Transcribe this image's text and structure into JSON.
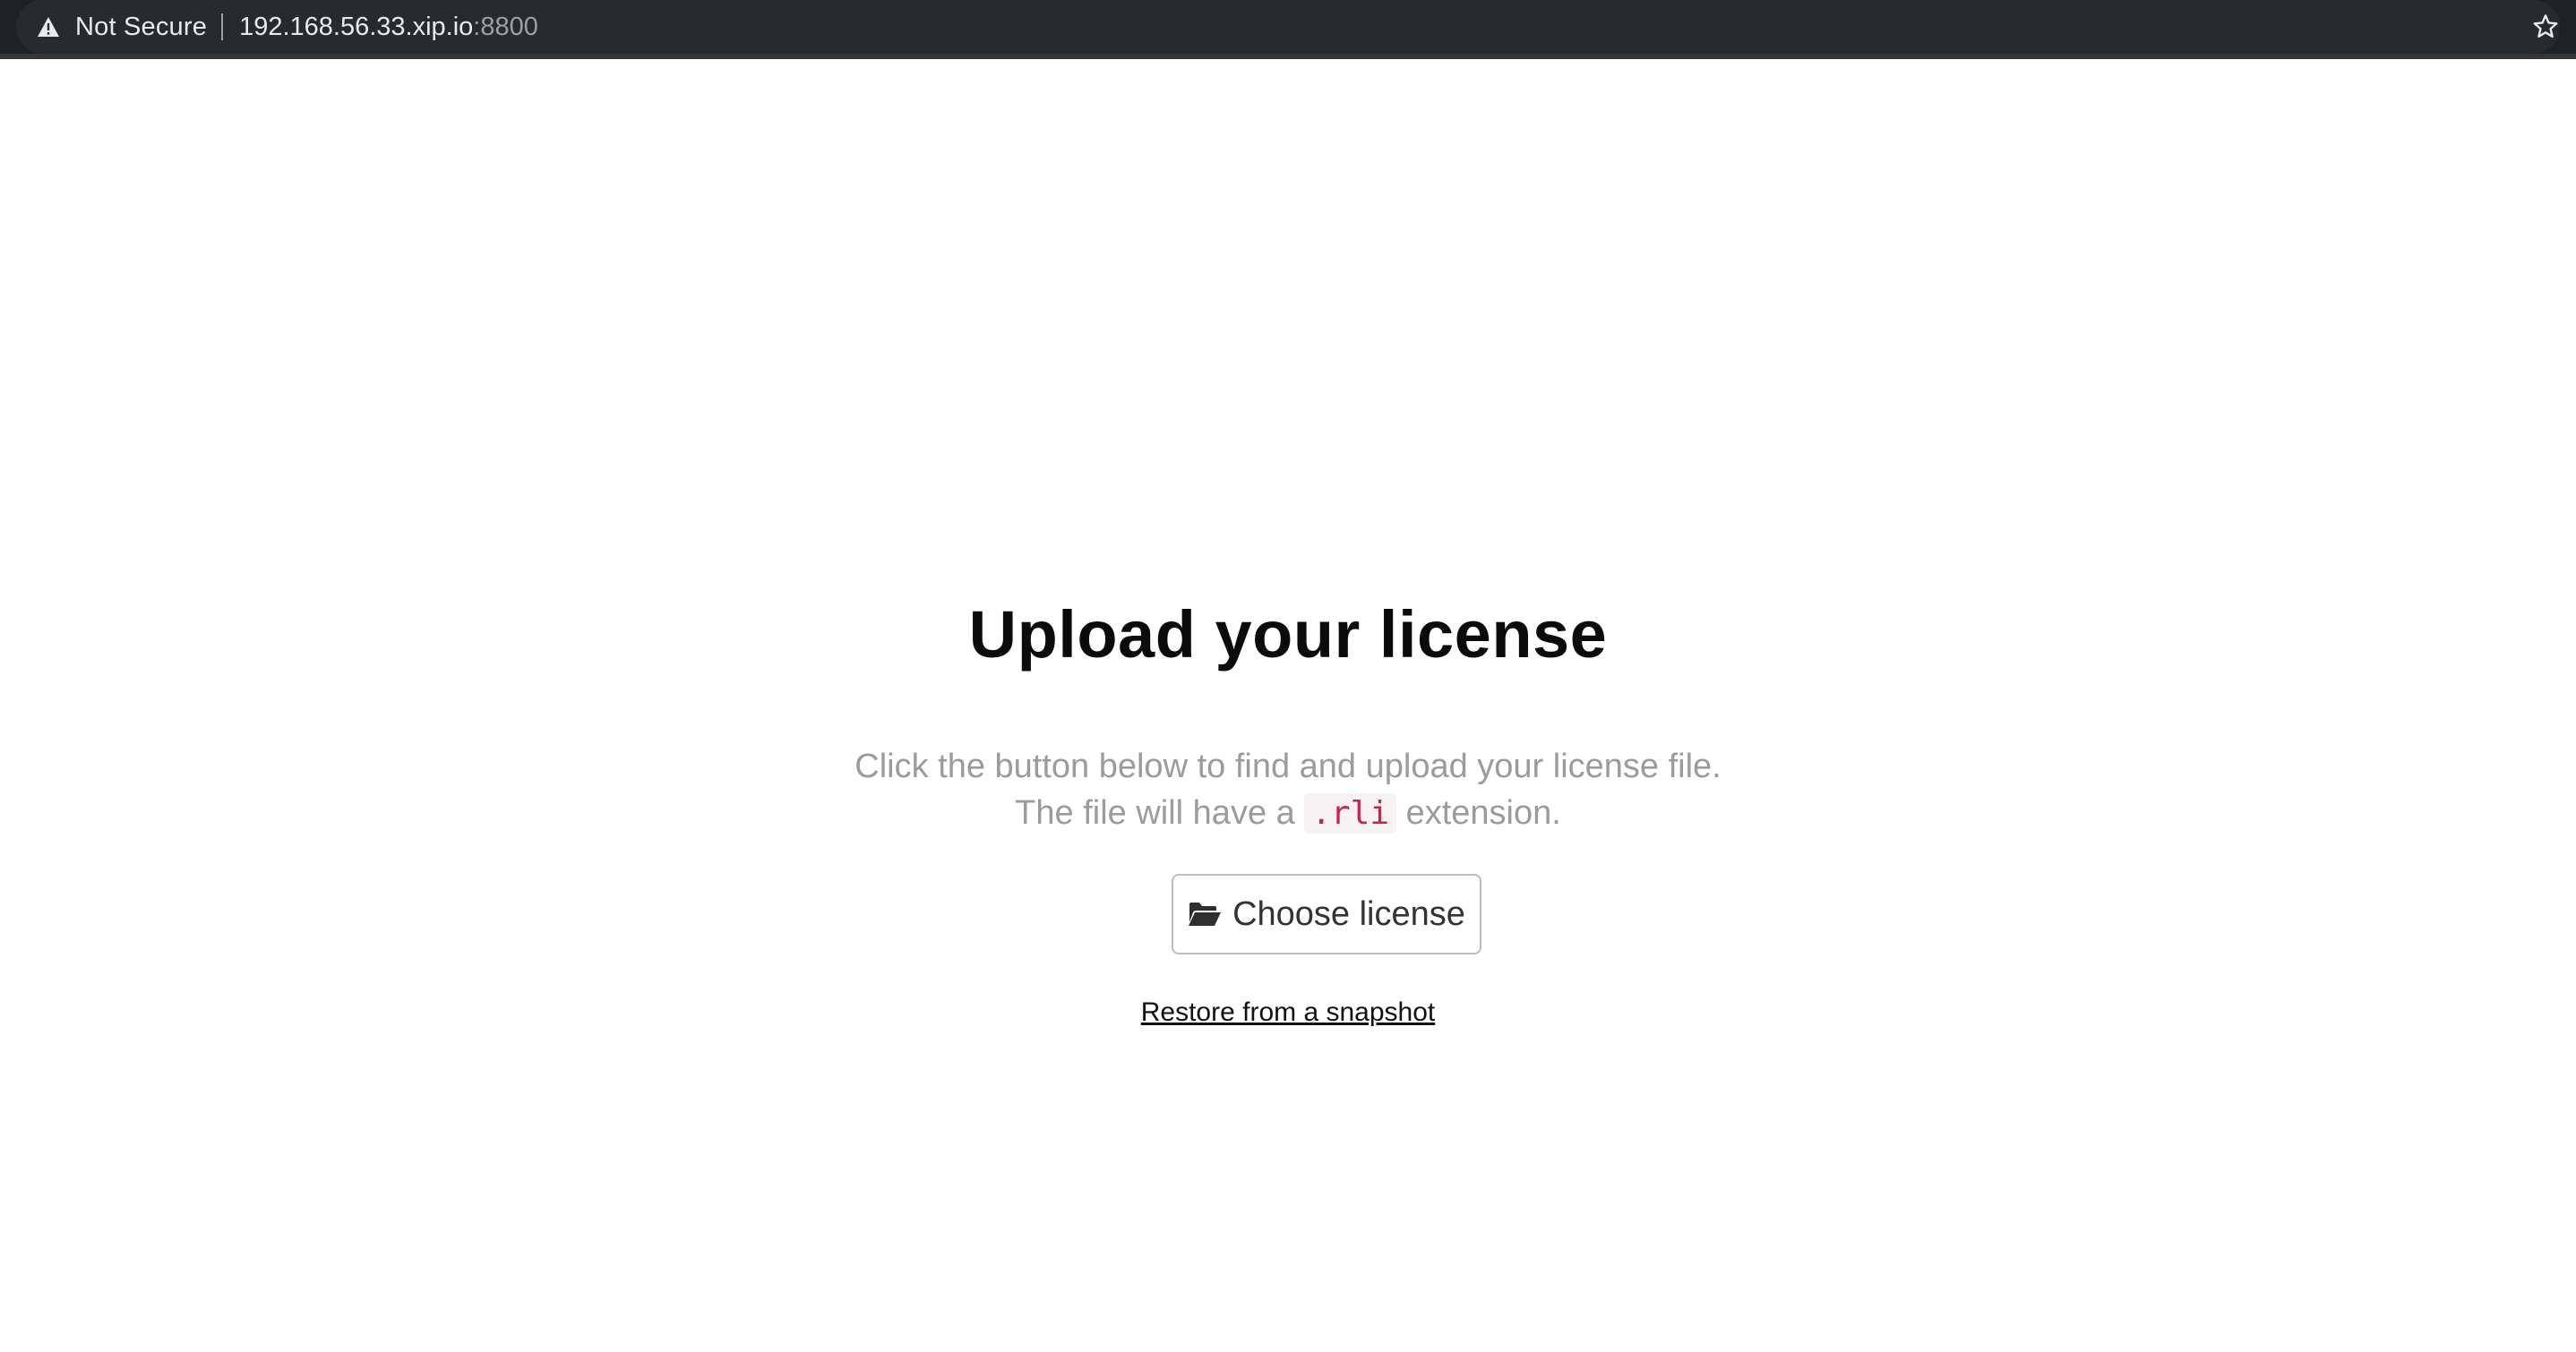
{
  "browser": {
    "security_label": "Not Secure",
    "url_host": "192.168.56.33.xip.io",
    "url_port": ":8800",
    "icons": {
      "security": "warning-triangle-icon",
      "bookmark": "star-icon"
    }
  },
  "page": {
    "title": "Upload your license",
    "description_line1": "Click the button below to find and upload your license file.",
    "description_line2_prefix": "The file will have a ",
    "extension": ".rli",
    "description_line2_suffix": " extension.",
    "choose_button_label": "Choose license",
    "choose_button_icon": "folder-open-icon",
    "restore_link_label": "Restore from a snapshot"
  },
  "colors": {
    "browser_bar": "#202124",
    "title": "#0b0b0b",
    "description": "#9b9b9b",
    "code_text": "#c7254e",
    "button_border": "#bdbdbd"
  }
}
